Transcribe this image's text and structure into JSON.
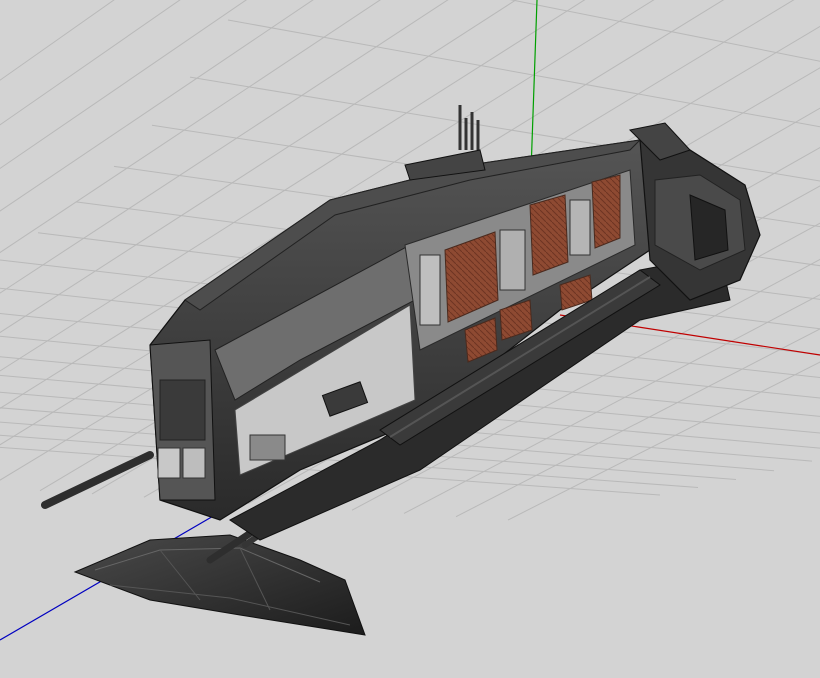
{
  "viewport": {
    "background": "#d3d3d3",
    "grid_color": "#b9b9b9",
    "grid_visible": true
  },
  "axes": {
    "x_axis_color": "#c00000",
    "y_axis_color": "#00a000",
    "z_axis_color": "#0000c0"
  },
  "model": {
    "hull_color": "#3c3c3c",
    "panel_color": "#8a8a8a",
    "light_panel_color": "#c8c8c8",
    "rust_panel_color": "#8e4a32",
    "icons": [
      "starship-model",
      "antenna-array",
      "turret-cannon",
      "landing-fin",
      "engine-nacelle"
    ]
  }
}
